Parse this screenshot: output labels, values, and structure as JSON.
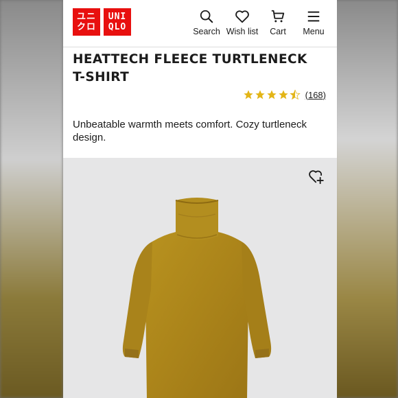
{
  "brand": {
    "logo_text_1": [
      "ユニ",
      "クロ"
    ],
    "logo_text_2": [
      "UNI",
      "QLO"
    ],
    "red": "#e8100f"
  },
  "nav": {
    "search": "Search",
    "wishlist": "Wish list",
    "cart": "Cart",
    "menu": "Menu"
  },
  "product": {
    "title": "HEATTECH FLEECE TURTLENECK T-SHIRT",
    "rating": 4.5,
    "review_count": "(168)",
    "description": "Unbeatable warmth meets comfort. Cozy turtleneck design.",
    "color_swatch": "#b08a1e"
  },
  "icons": {
    "search": "search-icon",
    "wishlist": "heart-icon",
    "cart": "cart-icon",
    "menu": "hamburger-icon",
    "add_wishlist": "heart-plus-icon"
  }
}
